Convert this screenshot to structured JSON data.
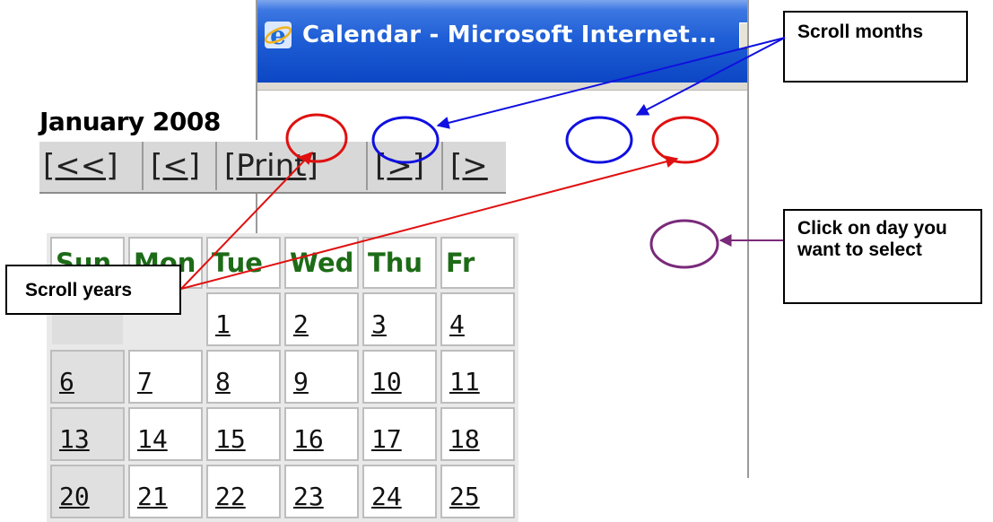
{
  "window": {
    "title": "Calendar - Microsoft Internet..."
  },
  "calendar": {
    "month_title": "January 2008",
    "nav": {
      "prev_year": "[<<]",
      "prev_month": "[<]",
      "print": "[Print]",
      "next_month": "[>]",
      "next_year": "[>"
    },
    "weekdays": [
      "Sun",
      "Mon",
      "Tue",
      "Wed",
      "Thu",
      "Fr"
    ],
    "weeks": [
      [
        "",
        "",
        "1",
        "2",
        "3",
        "4"
      ],
      [
        "6",
        "7",
        "8",
        "9",
        "10",
        "11"
      ],
      [
        "13",
        "14",
        "15",
        "16",
        "17",
        "18"
      ],
      [
        "20",
        "21",
        "22",
        "23",
        "24",
        "25"
      ]
    ]
  },
  "callouts": {
    "scroll_months": "Scroll months",
    "scroll_years": "Scroll years",
    "click_day": "Click on day you want to select"
  },
  "colors": {
    "weekday_header": "#1d6b17",
    "month_arrows": "#1010e0",
    "year_arrows": "#e01010",
    "day_arrow": "#7a2a7a",
    "titlebar": "#0c46c4"
  }
}
